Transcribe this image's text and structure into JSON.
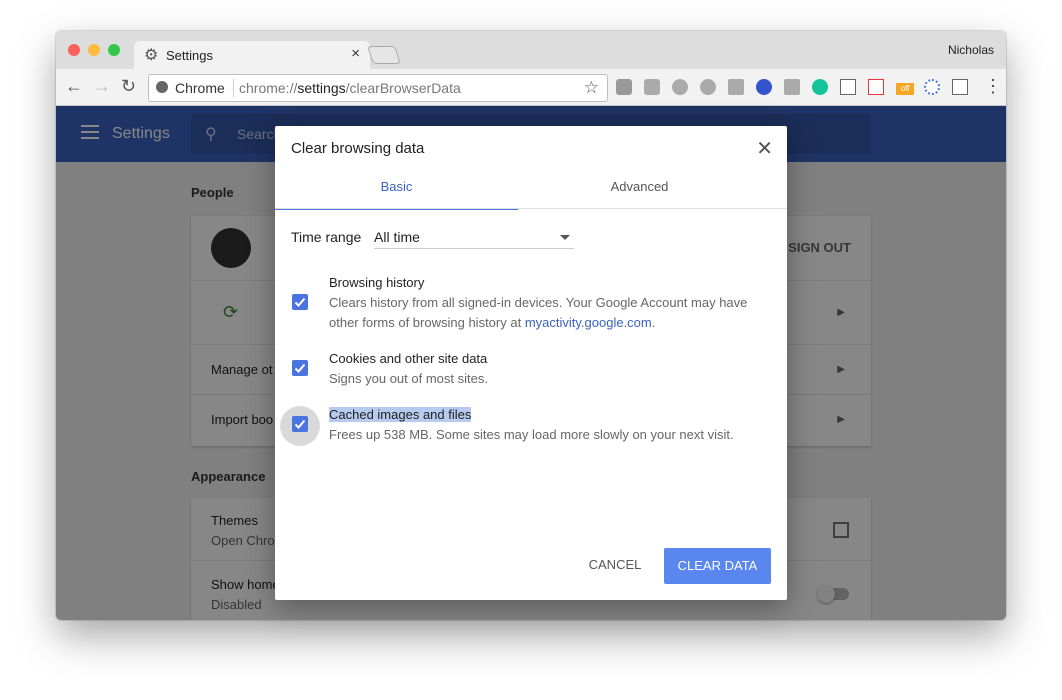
{
  "browser": {
    "tab_title": "Settings",
    "tab_close": "×",
    "user_name": "Nicholas",
    "omnibox_site": "Chrome",
    "omnibox_scheme": "chrome://",
    "omnibox_host": "settings",
    "omnibox_path": "/clearBrowserData",
    "back": "←",
    "forward": "→",
    "reload": "↻",
    "star": "☆",
    "menu": "⋮",
    "ext_badge": "off"
  },
  "settings": {
    "title": "Settings",
    "search_placeholder": "Search",
    "sections": {
      "people": "People",
      "appearance": "Appearance"
    },
    "rows": {
      "sign_out": "SIGN OUT",
      "manage_other": "Manage ot",
      "import": "Import boo",
      "themes": "Themes",
      "themes_sub": "Open Chro",
      "show_home": "Show home",
      "show_home_sub": "Disabled"
    }
  },
  "dialog": {
    "title": "Clear browsing data",
    "close": "✕",
    "tabs": [
      "Basic",
      "Advanced"
    ],
    "time_range_label": "Time range",
    "time_range_value": "All time",
    "options": [
      {
        "title": "Browsing history",
        "desc": "Clears history from all signed-in devices. Your Google Account may have other forms of browsing history at",
        "link": "myactivity.google.com",
        "link_suffix": ".",
        "checked": true
      },
      {
        "title": "Cookies and other site data",
        "desc": "Signs you out of most sites.",
        "checked": true
      },
      {
        "title": "Cached images and files",
        "desc": "Frees up 538 MB. Some sites may load more slowly on your next visit.",
        "checked": true
      }
    ],
    "cancel_label": "CANCEL",
    "clear_label": "CLEAR DATA"
  },
  "colors": {
    "accent": "#4a75e0",
    "header": "#3b62c0",
    "clear_button": "#5a86ef"
  }
}
